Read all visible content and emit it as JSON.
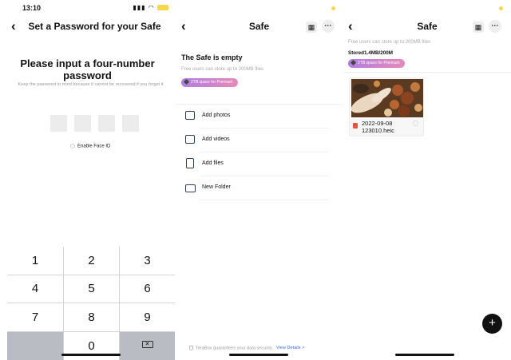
{
  "status_bar": {
    "time": "13:10"
  },
  "set_password": {
    "title": "Set a Password for your Safe",
    "heading": "Please input a four-number password",
    "hint": "Keep the password in mind because it cannot be recovered if you forget it",
    "face_id_label": "Enable Face ID",
    "keypad": [
      "1",
      "2",
      "3",
      "4",
      "5",
      "6",
      "7",
      "8",
      "9",
      "0"
    ]
  },
  "safe_empty": {
    "title": "Safe",
    "empty_title": "The Safe is empty",
    "storage_note": "Free users can store up to 200MB files",
    "premium_badge": "2TB space for Premium",
    "actions": [
      {
        "label": "Add photos",
        "icon": "photo-icon"
      },
      {
        "label": "Add videos",
        "icon": "video-icon"
      },
      {
        "label": "Add files",
        "icon": "file-icon"
      },
      {
        "label": "New Folder",
        "icon": "folder-icon"
      }
    ],
    "footer": "TeraBox guarantees your data security.",
    "view_details": "View Details >"
  },
  "safe_files": {
    "title": "Safe",
    "storage_note": "Free users can store up to 200MB files",
    "stored": "Stored1.4MB/200M",
    "premium_badge": "2TB space for Premium",
    "file": {
      "name_line1": "2022-09-08",
      "name_line2": "123010.heic",
      "type_icon": "image-file-icon"
    }
  },
  "colors": {
    "premium_gradient_start": "#b27de0",
    "premium_gradient_end": "#e58ab8",
    "link": "#3a6ad9",
    "fab": "#111111"
  }
}
